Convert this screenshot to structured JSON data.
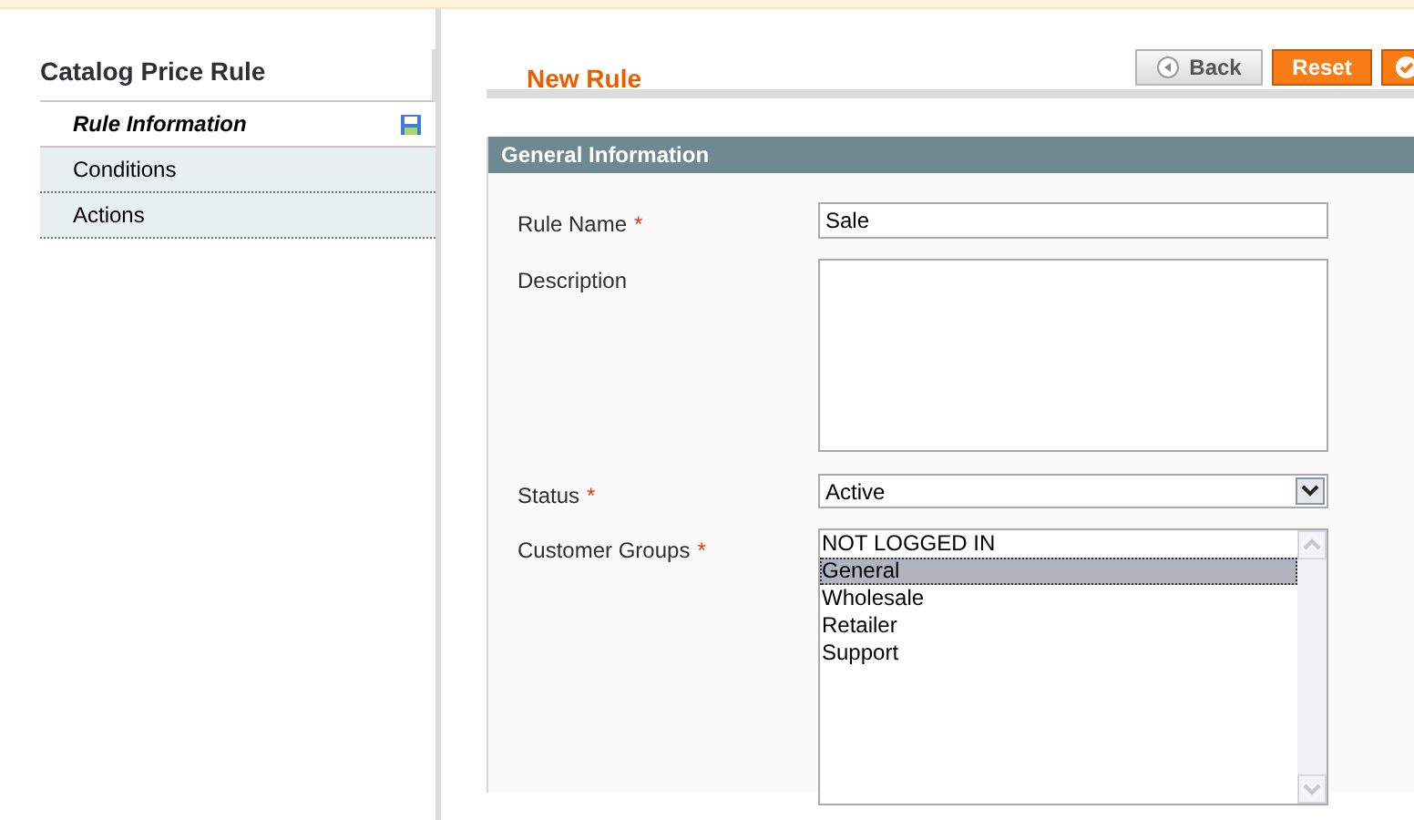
{
  "sidebar": {
    "title": "Catalog Price Rule",
    "tabs": [
      {
        "label": "Rule Information",
        "selected": true,
        "changed": true
      },
      {
        "label": "Conditions",
        "selected": false,
        "changed": false
      },
      {
        "label": "Actions",
        "selected": false,
        "changed": false
      }
    ]
  },
  "header": {
    "title": "New Rule",
    "buttons": [
      {
        "kind": "back",
        "label": "Back"
      },
      {
        "kind": "primary",
        "label": "Reset"
      },
      {
        "kind": "save"
      }
    ]
  },
  "section": {
    "title": "General Information",
    "fields": [
      {
        "kind": "text",
        "label": "Rule Name",
        "required_mark": "*",
        "value": "Sale"
      },
      {
        "kind": "textarea",
        "label": "Description"
      },
      {
        "kind": "select",
        "label": "Status",
        "required_mark": "*",
        "value": "Active"
      },
      {
        "kind": "multiselect",
        "label": "Customer Groups",
        "required_mark": "*",
        "options": [
          {
            "label": "NOT LOGGED IN",
            "selected": false
          },
          {
            "label": "General",
            "selected": true
          },
          {
            "label": "Wholesale",
            "selected": false
          },
          {
            "label": "Retailer",
            "selected": false
          },
          {
            "label": "Support",
            "selected": false
          }
        ]
      }
    ]
  }
}
